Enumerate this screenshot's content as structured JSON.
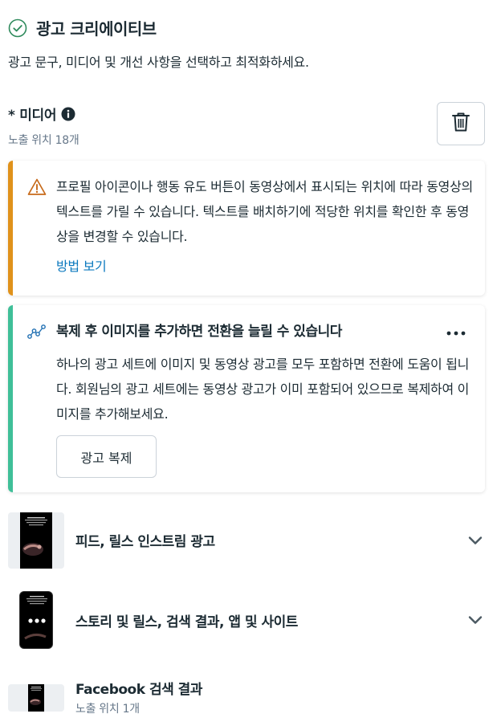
{
  "section": {
    "title": "광고 크리에이티브",
    "description": "광고 문구, 미디어 및 개선 사항을 선택하고 최적화하세요."
  },
  "media": {
    "label": "* 미디어",
    "placements_count": "노출 위치 18개"
  },
  "warning": {
    "text": "프로필 아이콘이나 행동 유도 버튼이 동영상에서 표시되는 위치에 따라 동영상의 텍스트를 가릴 수 있습니다. 텍스트를 배치하기에 적당한 위치를 확인한 후 동영상을 변경할 수 있습니다.",
    "link": "방법 보기"
  },
  "tip": {
    "title": "복제 후 이미지를 추가하면 전환을 늘릴 수 있습니다",
    "text": "하나의 광고 세트에 이미지 및 동영상 광고를 모두 포함하면 전환에 도움이 됩니다. 회원님의 광고 세트에는 동영상 광고가 이미 포함되어 있으므로 복제하여 이미지를 추가해보세요.",
    "button": "광고 복제"
  },
  "placements": [
    {
      "label": "피드, 릴스 인스트림 광고"
    },
    {
      "label": "스토리 및 릴스, 검색 결과, 앱 및 사이트"
    },
    {
      "label": "Facebook 검색 결과",
      "sub": "노출 위치 1개"
    }
  ],
  "icons": {
    "check": "check-circle-icon",
    "info": "info-icon",
    "trash": "trash-icon",
    "warning": "warning-triangle-icon",
    "tip": "trend-line-icon",
    "more": "more-dots-icon",
    "chevron": "chevron-down-icon"
  },
  "colors": {
    "warning_bar": "#e0921b",
    "tip_bar": "#3fbf98",
    "link": "#0a78be",
    "check": "#2e8a5c"
  }
}
